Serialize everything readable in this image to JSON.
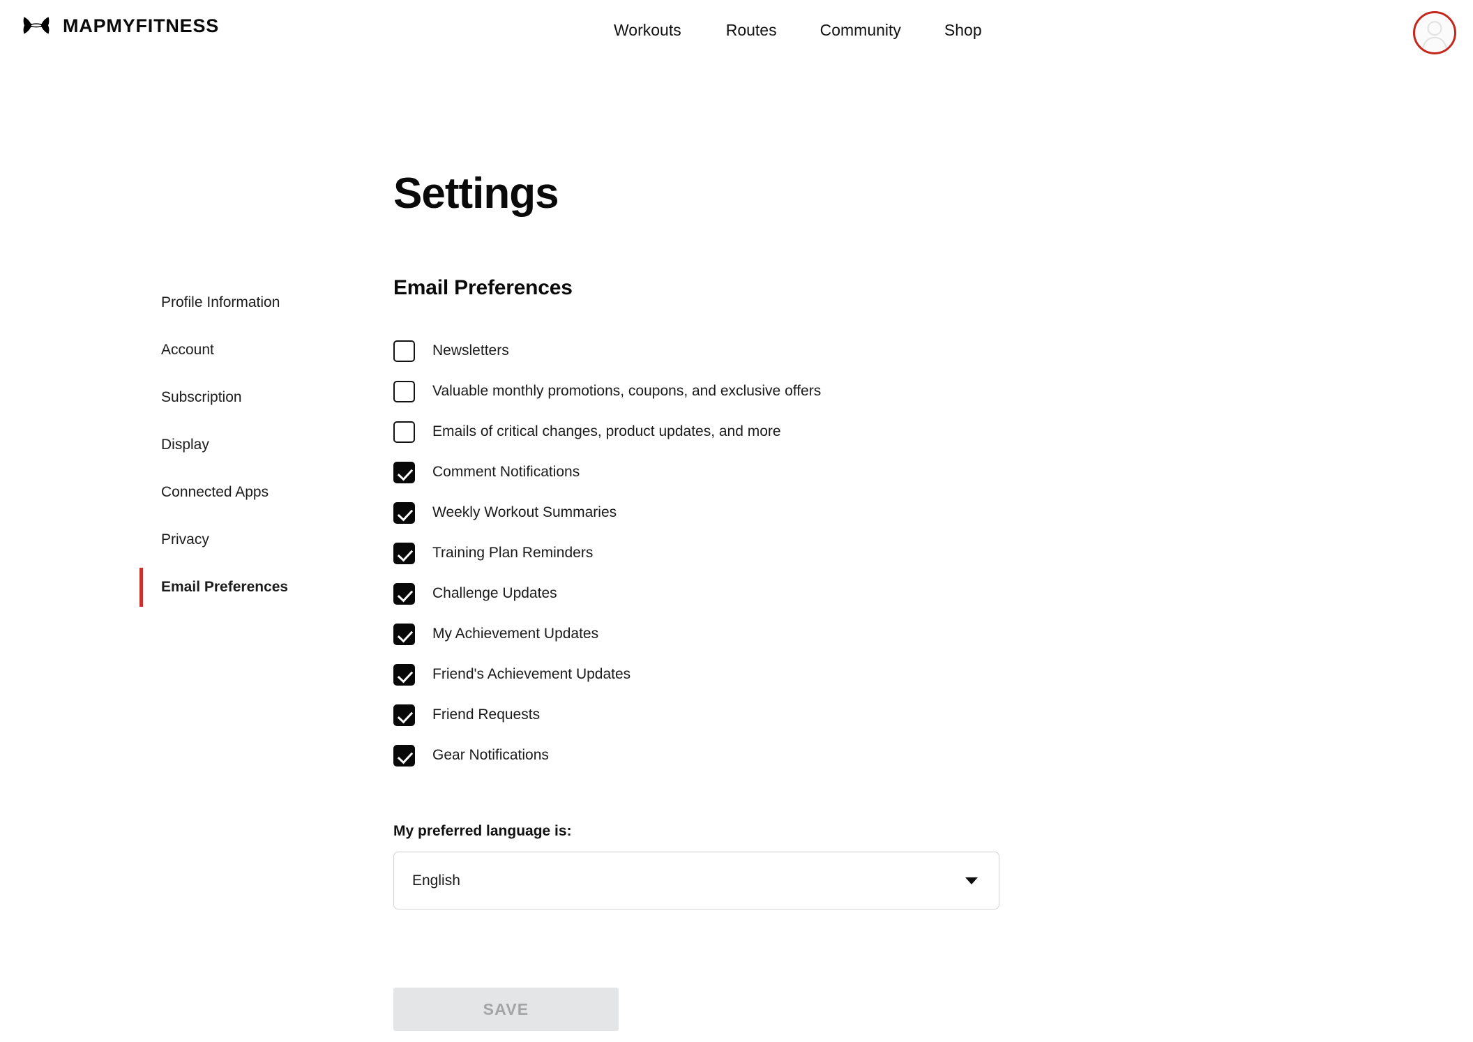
{
  "header": {
    "brand_name": "MAPMYFITNESS",
    "logo_icon": "under-armour-logo-icon",
    "nav": [
      {
        "label": "Workouts"
      },
      {
        "label": "Routes"
      },
      {
        "label": "Community"
      },
      {
        "label": "Shop"
      }
    ],
    "avatar": {
      "icon": "user-avatar-icon",
      "ring_color": "#c3281f"
    }
  },
  "page": {
    "title": "Settings"
  },
  "sidebar": {
    "items": [
      {
        "label": "Profile Information",
        "active": false
      },
      {
        "label": "Account",
        "active": false
      },
      {
        "label": "Subscription",
        "active": false
      },
      {
        "label": "Display",
        "active": false
      },
      {
        "label": "Connected Apps",
        "active": false
      },
      {
        "label": "Privacy",
        "active": false
      },
      {
        "label": "Email Preferences",
        "active": true
      }
    ],
    "active_accent_color": "#c8312c"
  },
  "main": {
    "section_title": "Email Preferences",
    "preferences": [
      {
        "label": "Newsletters",
        "checked": false
      },
      {
        "label": "Valuable monthly promotions, coupons, and exclusive offers",
        "checked": false
      },
      {
        "label": "Emails of critical changes, product updates, and more",
        "checked": false
      },
      {
        "label": "Comment Notifications",
        "checked": true
      },
      {
        "label": "Weekly Workout Summaries",
        "checked": true
      },
      {
        "label": "Training Plan Reminders",
        "checked": true
      },
      {
        "label": "Challenge Updates",
        "checked": true
      },
      {
        "label": "My Achievement Updates",
        "checked": true
      },
      {
        "label": "Friend's Achievement Updates",
        "checked": true
      },
      {
        "label": "Friend Requests",
        "checked": true
      },
      {
        "label": "Gear Notifications",
        "checked": true
      }
    ],
    "language": {
      "label": "My preferred language is:",
      "selected": "English",
      "caret_icon": "chevron-down-icon"
    },
    "save_button": {
      "label": "SAVE",
      "disabled": true,
      "background": "#e4e5e6",
      "text_color": "#a3a4a6"
    }
  }
}
